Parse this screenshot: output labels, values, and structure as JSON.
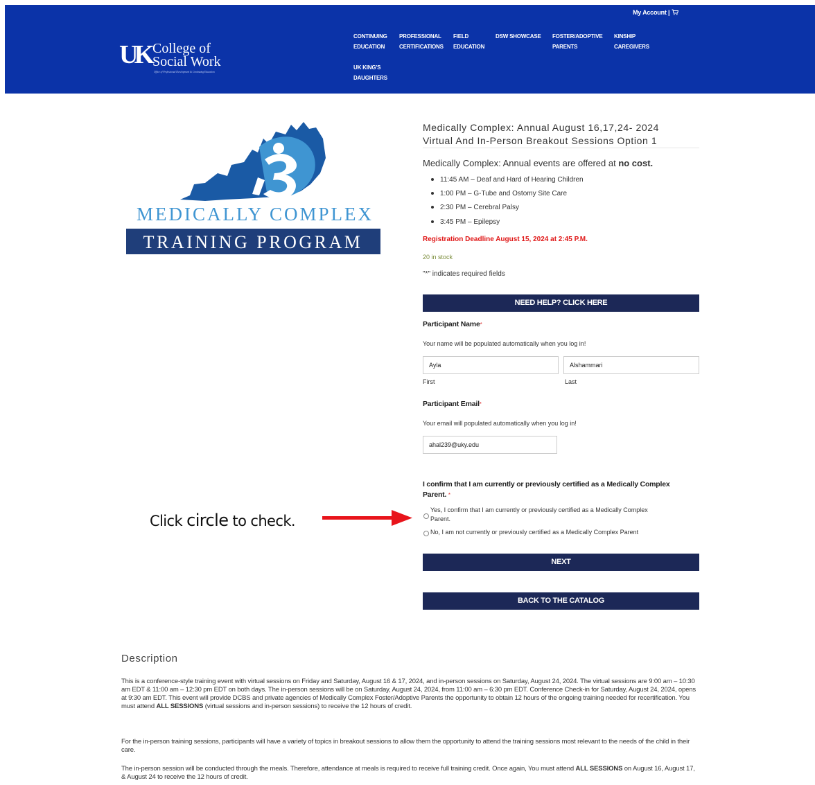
{
  "header": {
    "account": "My Account |",
    "cart_icon": "cart-icon",
    "logo_mark": "UK",
    "logo_line1": "College of",
    "logo_line2": "Social Work",
    "logo_sub": "Office of Professional Development & Continuing Education",
    "nav": [
      {
        "line1": "CONTINUING",
        "line2": "EDUCATION"
      },
      {
        "line1": "PROFESSIONAL",
        "line2": "CERTIFICATIONS"
      },
      {
        "line1": "FIELD",
        "line2": "EDUCATION"
      },
      {
        "line1": "DSW SHOWCASE",
        "line2": ""
      },
      {
        "line1": "FOSTER/ADOPTIVE",
        "line2": "PARENTS"
      },
      {
        "line1": "KINSHIP",
        "line2": "CAREGIVERS"
      },
      {
        "line1": "UK KING'S",
        "line2": "DAUGHTERS"
      }
    ],
    "color": "#0b33a8"
  },
  "program_logo": {
    "line1": "MEDICALLY COMPLEX",
    "line2": "TRAINING PROGRAM",
    "colors": {
      "dark_blue": "#1a5aa5",
      "light_blue": "#3f95d2",
      "navy": "#1f3e7a"
    }
  },
  "product": {
    "title_line1": "Medically Complex: Annual August 16,17,24- 2024",
    "title_line2": "Virtual And In-Person Breakout Sessions Option 1",
    "intro_prefix": "Medically Complex: Annual events are offered at ",
    "intro_bold": "no cost.",
    "sessions": [
      "11:45 AM – Deaf and Hard of Hearing Children",
      "1:00 PM – G-Tube and Ostomy Site Care",
      "2:30 PM – Cerebral Palsy",
      "3:45 PM – Epilepsy"
    ],
    "deadline": "Registration Deadline August 15, 2024 at 2:45 P.M.",
    "stock": "20 in stock",
    "required_note": "\"*\" indicates required fields",
    "help_button": "NEED HELP? CLICK HERE"
  },
  "form": {
    "name_label": "Participant Name",
    "name_desc": "Your name will be populated automatically when you log in!",
    "first_value": "Ayla",
    "last_value": "Alshammari",
    "first_label": "First",
    "last_label": "Last",
    "email_label": "Participant Email",
    "email_desc": "Your email will populated automatically when you log in!",
    "email_value": "ahal239@uky.edu",
    "required_mark": "*",
    "confirm_label": "I confirm that I am currently or previously certified as a Medically Complex Parent.",
    "option_yes_line1": "Yes, I confirm that I am currently or previously certified as a Medically Complex",
    "option_yes_line2": "Parent.",
    "option_no": "No, I am not currently or previously certified as a Medically Complex Parent",
    "next_button": "NEXT",
    "back_button": "BACK TO THE CATALOG",
    "button_color": "#1c2857"
  },
  "annotation": {
    "pre": "Click ",
    "emph": "circle",
    "post": " to check.",
    "arrow_color": "#e8141b"
  },
  "description": {
    "title": "Description",
    "p1_a": "This is a conference-style training event with virtual sessions on Friday and Saturday, August 16 & 17, 2024, and in-person sessions on Saturday, August 24, 2024. The virtual sessions are 9:00 am – 10:30 am EDT & 11:00 am – 12:30 pm EDT on both days. The in-person sessions will be on Saturday, August 24, 2024, from 11:00 am – 6:30 pm EDT. Conference Check-in for Saturday, August 24, 2024, opens at 9:30 am EDT. This event will provide DCBS and private agencies of Medically Complex Foster/Adoptive Parents the opportunity to obtain 12 hours of the ongoing training needed for recertification. You must attend ",
    "p1_bold": "ALL SESSIONS",
    "p1_b": " (virtual sessions and in-person sessions) to receive the 12 hours of credit.",
    "p2": "For the in-person training sessions, participants will have a variety of topics in breakout sessions to allow them the opportunity to attend the training sessions most relevant to the needs of the child in their care.",
    "p3_a": "The in-person session will be conducted through the meals. Therefore, attendance at meals is required to receive full training credit. Once again, You must attend ",
    "p3_bold": "ALL SESSIONS",
    "p3_b": " on August 16, August 17, & August 24 to receive the 12 hours of credit."
  }
}
